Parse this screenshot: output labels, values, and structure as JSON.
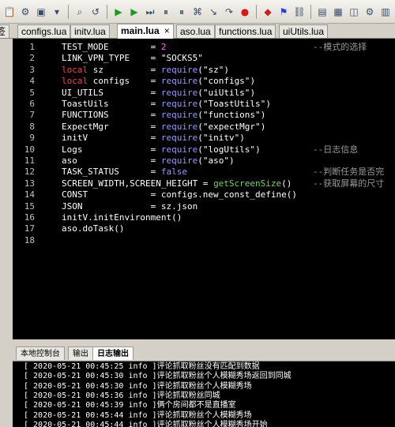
{
  "toolbar": {
    "icons": [
      "paste-icon",
      "compile-icon",
      "window-icon",
      "dropdown-icon",
      "search-icon",
      "replace-icon",
      "run-icon",
      "play-icon",
      "step-icon",
      "pause-icon",
      "pause-alt-icon",
      "debug-icon",
      "step-into-icon",
      "step-over-icon",
      "stop-icon",
      "breakpoint-icon",
      "bookmark-icon",
      "network-icon",
      "device-icon",
      "screen-icon",
      "layout-icon",
      "settings-icon",
      "panel-icon"
    ]
  },
  "tabs": [
    {
      "label": "configs.lua",
      "active": false
    },
    {
      "label": "initv.lua",
      "active": false
    },
    {
      "label": "main.lua",
      "active": true,
      "close": "×"
    },
    {
      "label": "aso.lua",
      "active": false
    },
    {
      "label": "functions.lua",
      "active": false
    },
    {
      "label": "uiUtils.lua",
      "active": false
    }
  ],
  "left_tab_fragment": "签",
  "editor": {
    "lines": [
      {
        "n": "1",
        "code": "TEST_MODE        = 2",
        "comment": "--模式的选择"
      },
      {
        "n": "2",
        "code": "LINK_VPN_TYPE    = \"SOCKS5\"",
        "comment": ""
      },
      {
        "n": "3",
        "code": "local sz         = require(\"sz\")",
        "comment": ""
      },
      {
        "n": "4",
        "code": "local configs    = require(\"configs\")",
        "comment": ""
      },
      {
        "n": "5",
        "code": "UI_UTILS         = require(\"uiUtils\")",
        "comment": ""
      },
      {
        "n": "6",
        "code": "ToastUils        = require(\"ToastUtils\")",
        "comment": ""
      },
      {
        "n": "7",
        "code": "FUNCTIONS        = require(\"functions\")",
        "comment": ""
      },
      {
        "n": "8",
        "code": "ExpectMgr        = require(\"expectMgr\")",
        "comment": ""
      },
      {
        "n": "9",
        "code": "initV            = require(\"initv\")",
        "comment": ""
      },
      {
        "n": "10",
        "code": "Logs             = require(\"logUtils\")",
        "comment": "--日志信息"
      },
      {
        "n": "11",
        "code": "aso              = require(\"aso\")",
        "comment": ""
      },
      {
        "n": "12",
        "code": "TASK_STATUS      = false",
        "comment": "--判断任务是否完"
      },
      {
        "n": "13",
        "code": "SCREEN_WIDTH,SCREEN_HEIGHT = getScreenSize()",
        "comment": "--获取屏幕的尺寸"
      },
      {
        "n": "14",
        "code": "CONST            = configs.new_const_define()",
        "comment": ""
      },
      {
        "n": "15",
        "code": "JSON             = sz.json",
        "comment": ""
      },
      {
        "n": "16",
        "code": "initV.initEnvironment()",
        "comment": ""
      },
      {
        "n": "17",
        "code": "aso.doTask()",
        "comment": ""
      },
      {
        "n": "18",
        "code": "",
        "comment": ""
      }
    ]
  },
  "panel": {
    "tabs": [
      {
        "label": "本地控制台",
        "active": false
      },
      {
        "label": "输出",
        "active": false
      },
      {
        "label": "日志输出",
        "active": true
      }
    ],
    "logs": [
      "[ 2020-05-21 00:45:25 info ]评论抓取粉丝没有匹配到数据",
      "[ 2020-05-21 00:45:30 info ]评论抓取粉丝个人模糊秀场返回到同城",
      "[ 2020-05-21 00:45:30 info ]评论抓取粉丝个人模糊秀场",
      "[ 2020-05-21 00:45:36 info ]评论抓取粉丝同城",
      "[ 2020-05-21 00:45:39 info ]俩个房间都不是直播室",
      "[ 2020-05-21 00:45:44 info ]评论抓取粉丝个人模糊秀场",
      "[ 2020-05-21 00:45:44 info ]评论抓取粉丝个人模糊秀场开始"
    ]
  }
}
